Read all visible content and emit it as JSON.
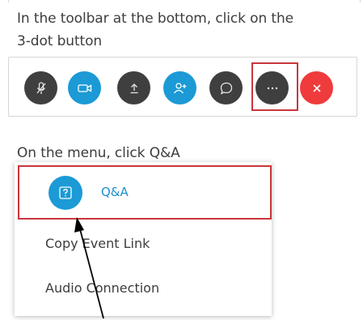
{
  "instructions": {
    "line1": "In the toolbar at the bottom, click on the",
    "line2": "3-dot button",
    "line3": "On the menu, click Q&A"
  },
  "toolbar": {
    "buttons": [
      {
        "icon": "microphone-muted-icon",
        "color": "#3f3f3f"
      },
      {
        "icon": "video-camera-icon",
        "color": "#1b9ad6"
      },
      {
        "icon": "share-upload-icon",
        "color": "#3f3f3f"
      },
      {
        "icon": "participants-add-icon",
        "color": "#1b9ad6"
      },
      {
        "icon": "chat-bubble-icon",
        "color": "#3f3f3f"
      },
      {
        "icon": "more-dots-icon",
        "color": "#3f3f3f"
      },
      {
        "icon": "close-x-icon",
        "color": "#ef3b3b"
      }
    ],
    "highlight_color": "#c9363c"
  },
  "menu": {
    "items": [
      {
        "label": "Q&A",
        "icon": "question-icon",
        "highlighted": true
      },
      {
        "label": "Copy Event Link"
      },
      {
        "label": "Audio Connection"
      }
    ]
  },
  "colors": {
    "accent_blue": "#1b9ad6",
    "dark_button": "#3f3f3f",
    "leave_red": "#ef3b3b",
    "highlight_red": "#c9363c"
  }
}
